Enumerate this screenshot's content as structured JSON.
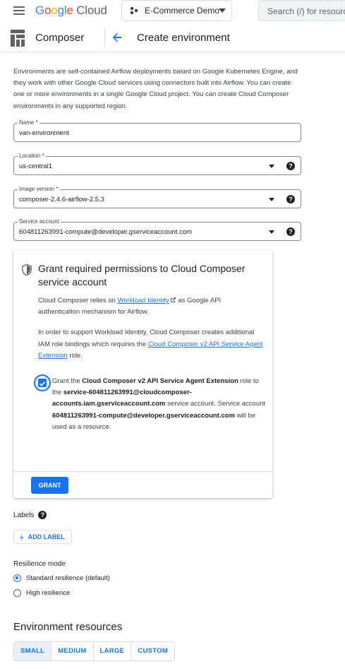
{
  "topbar": {
    "logo_google": "Google",
    "logo_cloud": "Cloud",
    "project": "E-Commerce Demo",
    "search_placeholder": "Search (/) for resources"
  },
  "header": {
    "product": "Composer",
    "page_title": "Create environment"
  },
  "intro": "Environments are self-contained Airflow deployments based on Google Kubernetes Engine, and they work with other Google Cloud services using connectors built into Airflow. You can create one or more environments in a single Google Cloud project. You can create Cloud Composer environments in any supported region.",
  "fields": {
    "name": {
      "label": "Name *",
      "value": "van-environment"
    },
    "location": {
      "label": "Location *",
      "value": "us-central1"
    },
    "image": {
      "label": "Image version *",
      "value": "composer-2.4.6-airflow-2.5.3"
    },
    "service_account": {
      "label": "Service account",
      "value": "604811263991-compute@developer.gserviceaccount.com"
    }
  },
  "card": {
    "title": "Grant required permissions to Cloud Composer service account",
    "p1_before": "Cloud Composer relies on ",
    "p1_link": "Workload Identity",
    "p1_after": " as Google API authentication mechanism for Airflow.",
    "p2_before": "In order to support Workload Identity, Cloud Composer creates additional IAM role bindings which requires the ",
    "p2_link": "Cloud Composer v2 API Service Agent Extension",
    "p2_after": " role.",
    "chk_1": "Grant the ",
    "chk_2": "Cloud Composer v2 API Service Agent Extension",
    "chk_3": " role to the ",
    "chk_4": "service-604811263991@cloudcomposer-accounts.iam.gserviceaccount.com",
    "chk_5": " service account. Service account ",
    "chk_6": "604811263991-compute@developer.gserviceaccount.com",
    "chk_7": " will be used as a resource.",
    "checked": true,
    "grant": "GRANT"
  },
  "labels": {
    "title": "Labels",
    "add": "ADD LABEL"
  },
  "resilience": {
    "title": "Resilience mode",
    "options": [
      "Standard resilience (default)",
      "High resilience"
    ],
    "selected": 0
  },
  "env_resources": {
    "title": "Environment resources",
    "options": [
      "SMALL",
      "MEDIUM",
      "LARGE",
      "CUSTOM"
    ],
    "selected": "SMALL"
  },
  "colors": {
    "accent": "#1a73e8",
    "accent_light": "#e8f0fe",
    "border": "#dadce0"
  }
}
